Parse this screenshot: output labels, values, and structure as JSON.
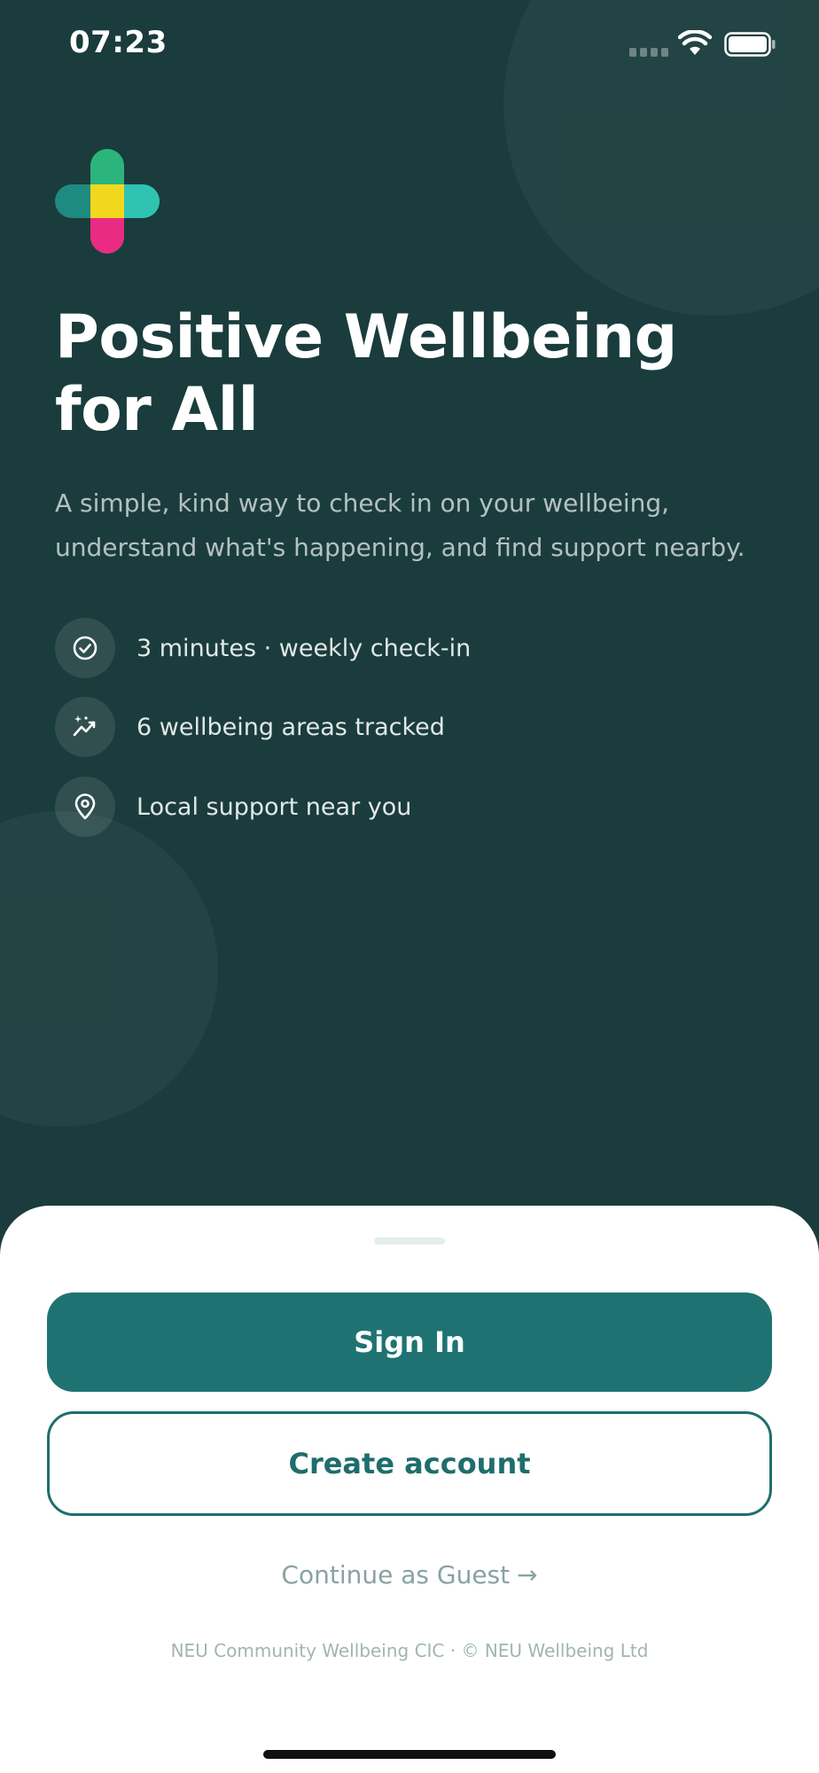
{
  "status_bar": {
    "time": "07:23"
  },
  "hero": {
    "title_lines": [
      "Positive Wellbeing",
      "for All"
    ],
    "subtitle_lines": [
      "A simple, kind way to check in on your wellbeing,",
      "understand what's happening, and find support nearby."
    ]
  },
  "features": [
    {
      "icon": "check-circle-icon",
      "label": "3 minutes · weekly check-in"
    },
    {
      "icon": "trend-sparkle-icon",
      "label": "6 wellbeing areas tracked"
    },
    {
      "icon": "location-pin-icon",
      "label": "Local support near you"
    }
  ],
  "actions": {
    "sign_in": "Sign In",
    "create_account": "Create account",
    "guest": "Continue as Guest",
    "guest_arrow": "→"
  },
  "footer": {
    "text": "NEU Community Wellbeing CIC · © NEU Wellbeing Ltd"
  },
  "colors": {
    "background": "#1a3c3c",
    "accent": "#1e7372",
    "logo_green": "#2bb57c",
    "logo_teal": "#2fc4b2",
    "logo_yellow": "#f2d81d",
    "logo_pink": "#ea2b83"
  }
}
